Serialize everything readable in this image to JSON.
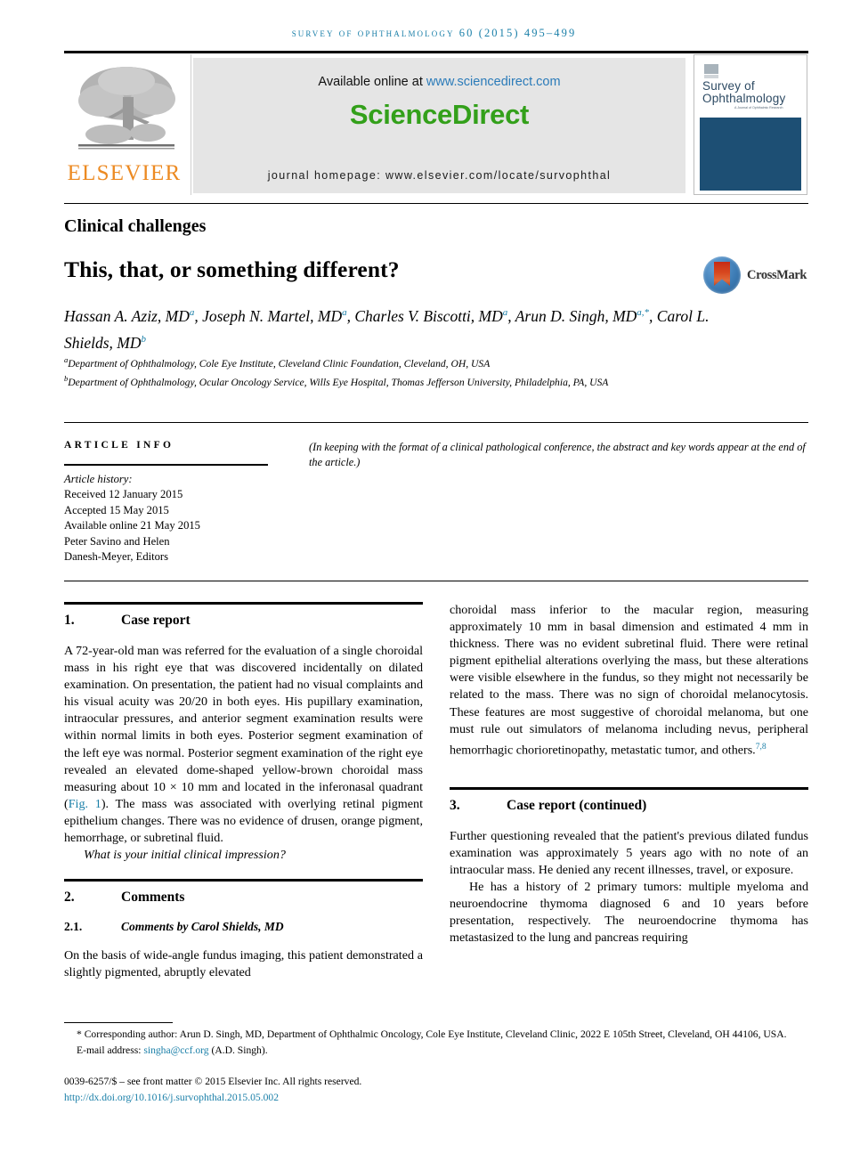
{
  "running_head": "Survey of Ophthalmology 60 (2015) 495–499",
  "masthead": {
    "elsevier_wordmark": "ELSEVIER",
    "available_prefix": "Available online at ",
    "available_url": "www.sciencedirect.com",
    "sciencedirect_logo": "ScienceDirect",
    "journal_homepage": "journal homepage: www.elsevier.com/locate/survophthal",
    "cover_title_line1": "Survey of",
    "cover_title_line2": "Ophthalmology",
    "cover_subtitle": "A Journal of Ophthalmic Research",
    "colors": {
      "running_head_teal": "#1a7fa8",
      "sciencedirect_green": "#33a01a",
      "elsevier_orange": "#ec8a22",
      "link_blue": "#2b7bb9",
      "cover_navy": "#1d4f74"
    }
  },
  "title_block": {
    "kicker": "Clinical challenges",
    "title": "This, that, or something different?",
    "crossmark_label": "CrossMark",
    "authors_line1": "Hassan A. Aziz, MD",
    "authors": [
      {
        "name": "Hassan A. Aziz, MD",
        "sup": "a"
      },
      {
        "name": "Joseph N. Martel, MD",
        "sup": "a"
      },
      {
        "name": "Charles V. Biscotti, MD",
        "sup": "a"
      },
      {
        "name": "Arun D. Singh, MD",
        "sup": "a,*"
      },
      {
        "name": "Carol L. Shields, MD",
        "sup": "b"
      }
    ],
    "affiliation_a": "Department of Ophthalmology, Cole Eye Institute, Cleveland Clinic Foundation, Cleveland, OH, USA",
    "affiliation_b": "Department of Ophthalmology, Ocular Oncology Service, Wills Eye Hospital, Thomas Jefferson University, Philadelphia, PA, USA"
  },
  "article_info": {
    "heading": "ARTICLE INFO",
    "history_label": "Article history:",
    "received": "Received 12 January 2015",
    "accepted": "Accepted 15 May 2015",
    "available_online": "Available online 21 May 2015",
    "editors_line1": "Peter Savino and Helen",
    "editors_line2": "Danesh-Meyer, Editors",
    "abstract_note": "(In keeping with the format of a clinical pathological conference, the abstract and key words appear at the end of the article.)"
  },
  "sections": {
    "case_report": {
      "number": "1.",
      "title": "Case report",
      "para1_a": "A 72-year-old man was referred for the evaluation of a single choroidal mass in his right eye that was discovered incidentally on dilated examination. On presentation, the patient had no visual complaints and his visual acuity was 20/20 in both eyes. His pupillary examination, intraocular pressures, and anterior segment examination results were within normal limits in both eyes. Posterior segment examination of the left eye was normal. Posterior segment examination of the right eye revealed an elevated dome-shaped yellow-brown choroidal mass measuring about 10 × 10 mm and located in the inferonasal quadrant (",
      "fig_link": "Fig. 1",
      "para1_b": "). The mass was associated with overlying retinal pigment epithelium changes. There was no evidence of drusen, orange pigment, hemorrhage, or subretinal fluid.",
      "para2": "What is your initial clinical impression?"
    },
    "comments": {
      "number": "2.",
      "title": "Comments",
      "sub_number": "2.1.",
      "sub_title": "Comments by Carol Shields, MD",
      "para1": "On the basis of wide-angle fundus imaging, this patient demonstrated a slightly pigmented, abruptly elevated"
    },
    "right_continuation": {
      "text_a": "choroidal mass inferior to the macular region, measuring approximately 10 mm in basal dimension and estimated 4 mm in thickness. There was no evident subretinal fluid. There were retinal pigment epithelial alterations overlying the mass, but these alterations were visible elsewhere in the fundus, so they might not necessarily be related to the mass. There was no sign of choroidal melanocytosis. These features are most suggestive of choroidal melanoma, but one must rule out simulators of melanoma including nevus, peripheral hemorrhagic chorioretinopathy, metastatic tumor, and others.",
      "ref_sup": "7,8"
    },
    "case_report_continued": {
      "number": "3.",
      "title": "Case report (continued)",
      "para1": "Further questioning revealed that the patient's previous dilated fundus examination was approximately 5 years ago with no note of an intraocular mass. He denied any recent illnesses, travel, or exposure.",
      "para2": "He has a history of 2 primary tumors: multiple myeloma and neuroendocrine thymoma diagnosed 6 and 10 years before presentation, respectively. The neuroendocrine thymoma has metastasized to the lung and pancreas requiring"
    }
  },
  "footer": {
    "corresponding_marker": "*",
    "corresponding_text": " Corresponding author: Arun D. Singh, MD, Department of Ophthalmic Oncology, Cole Eye Institute, Cleveland Clinic, 2022 E 105th Street, Cleveland, OH 44106, USA.",
    "email_label": "E-mail address: ",
    "email": "singha@ccf.org",
    "email_suffix": " (A.D. Singh).",
    "copyright": "0039-6257/$ – see front matter © 2015 Elsevier Inc. All rights reserved.",
    "doi": "http://dx.doi.org/10.1016/j.survophthal.2015.05.002"
  }
}
